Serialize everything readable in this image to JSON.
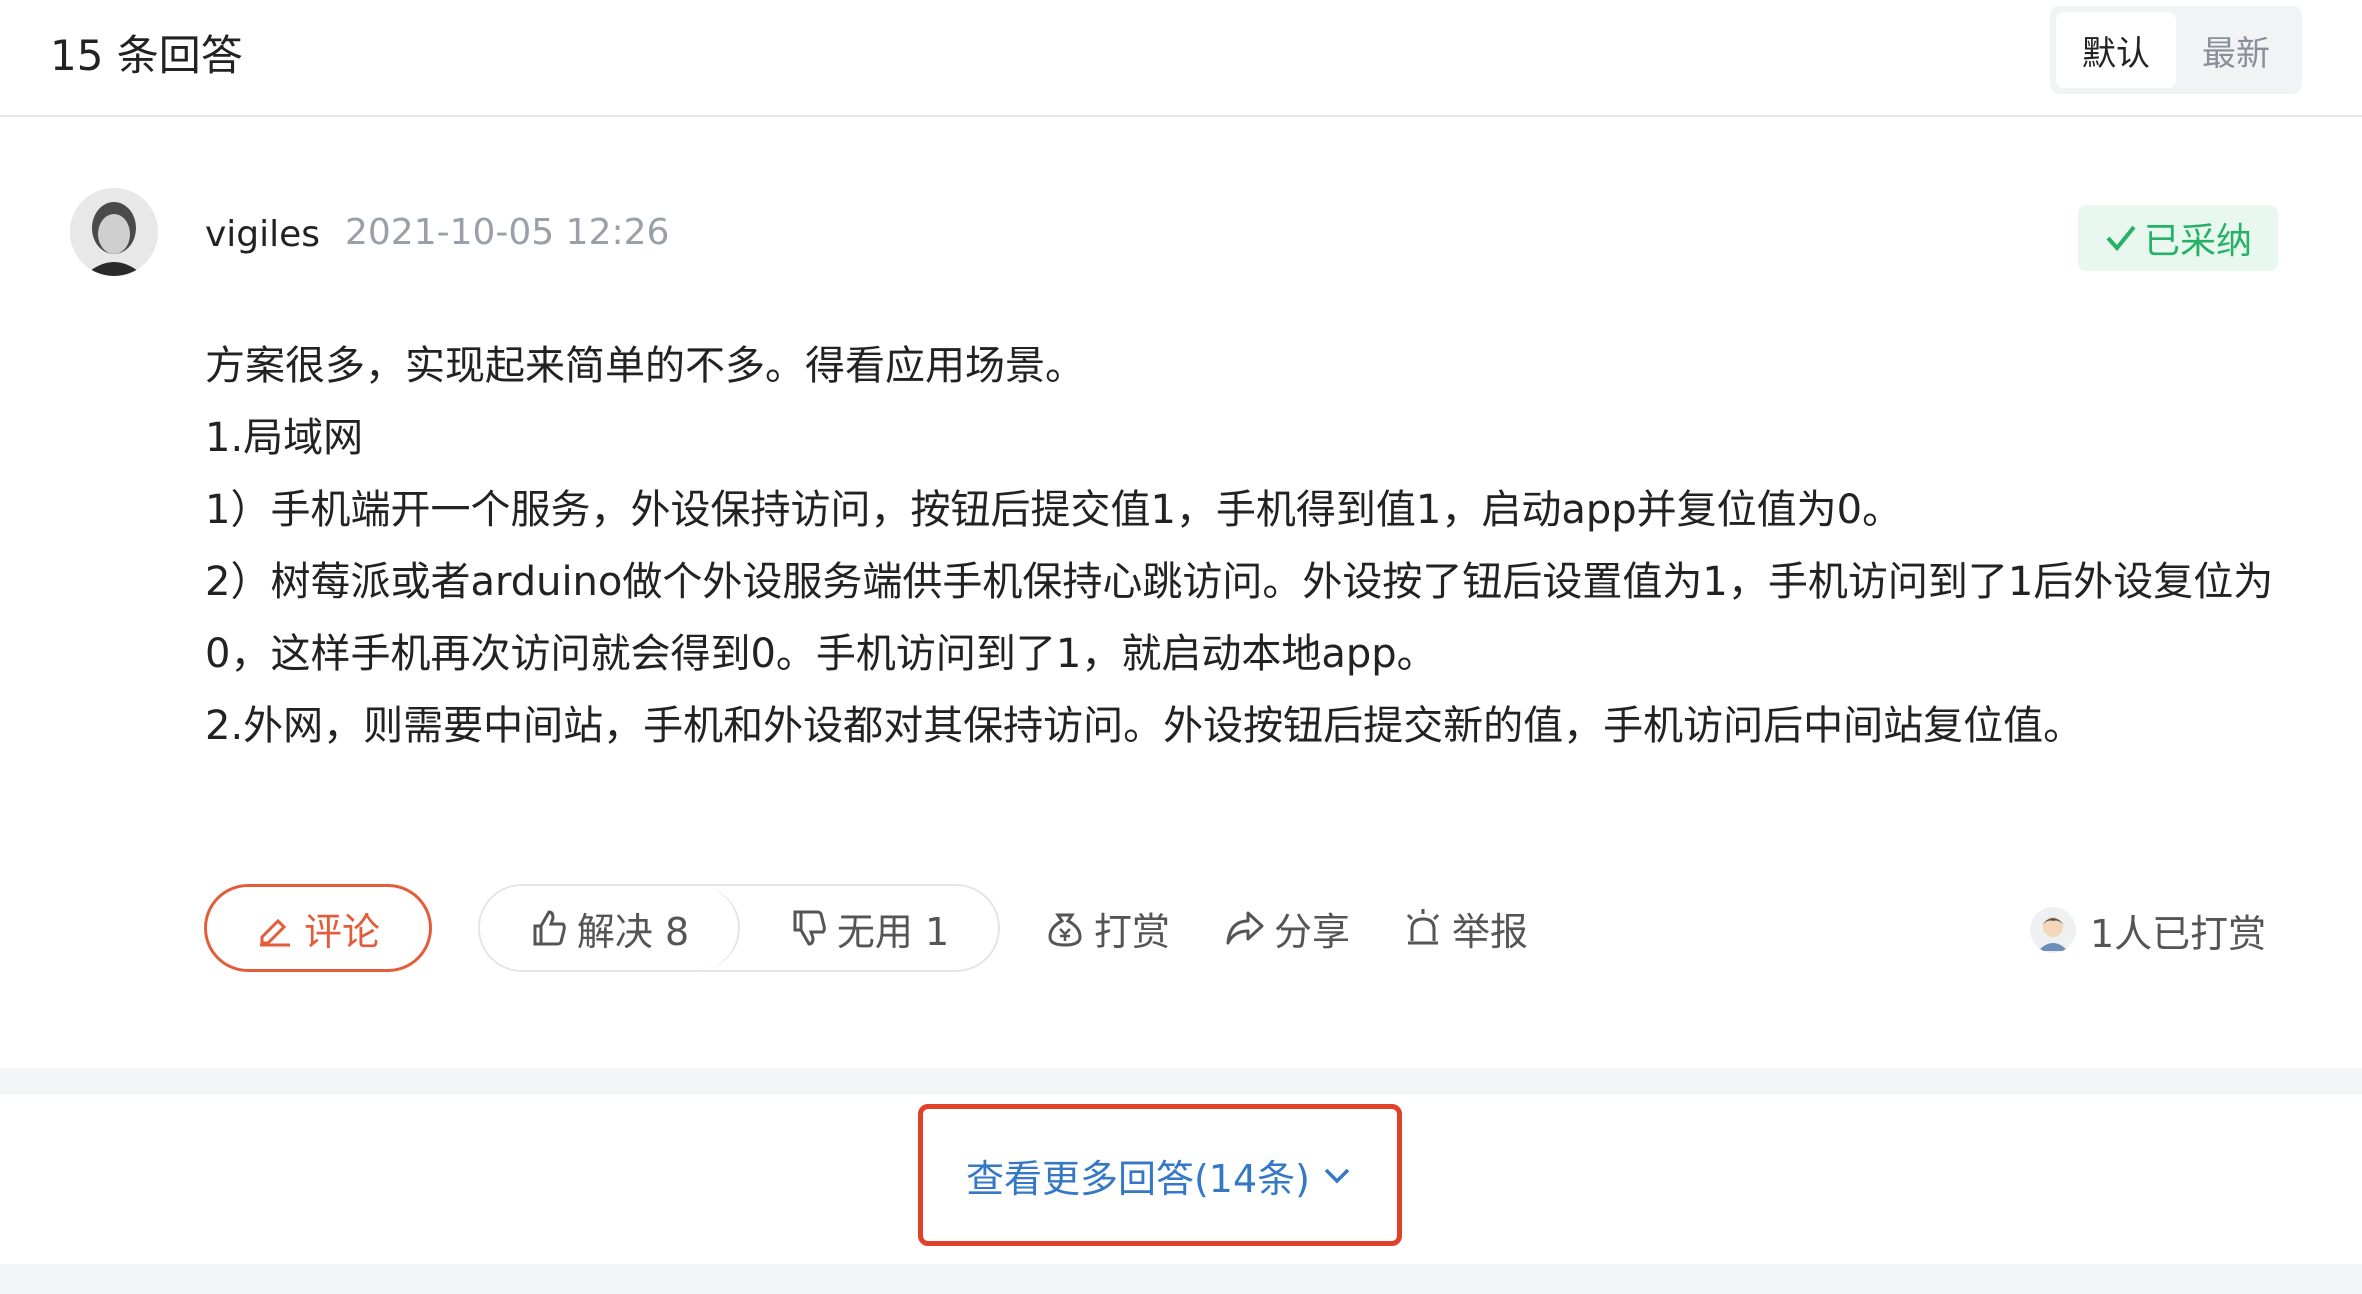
{
  "header": {
    "answer_count": "15 条回答",
    "sort_options": [
      {
        "label": "默认",
        "active": true
      },
      {
        "label": "最新",
        "active": false
      }
    ]
  },
  "answer": {
    "author": "vigiles",
    "time": "2021-10-05 12:26",
    "accepted_label": "已采纳",
    "content_lines": [
      "方案很多，实现起来简单的不多。得看应用场景。",
      "1.局域网",
      "1）手机端开一个服务，外设保持访问，按钮后提交值1，手机得到值1，启动app并复位值为0。",
      "2）树莓派或者arduino做个外设服务端供手机保持心跳访问。外设按了钮后设置值为1，手机访问到了1后外设复位为0，这样手机再次访问就会得到0。手机访问到了1，就启动本地app。",
      "2.外网，则需要中间站，手机和外设都对其保持访问。外设按钮后提交新的值，手机访问后中间站复位值。"
    ],
    "actions": {
      "comment": "评论",
      "solved": "解决 8",
      "useless": "无用 1",
      "tip": "打赏",
      "share": "分享",
      "report": "举报",
      "tipped_info": "1人已打赏"
    }
  },
  "more_answers": {
    "label": "查看更多回答(14条)"
  },
  "colors": {
    "accent_orange": "#e35d3a",
    "accepted_green": "#27b068",
    "link_blue": "#3478c6",
    "highlight_red": "#e0412a"
  }
}
